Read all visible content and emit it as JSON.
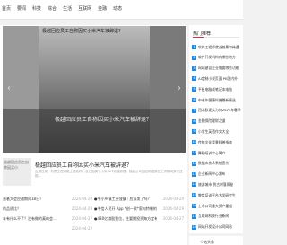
{
  "nav": [
    "首页",
    "要闻",
    "科技",
    "综合",
    "生活",
    "互联网",
    "金融",
    "动态"
  ],
  "banner": {
    "image_alt": "极越回应员工自称因买小米汽车被辞退？",
    "caption": "极越回应员工自称因买小米汽车被辞退？",
    "prev_icon": "chevron-left-icon",
    "next_icon": "chevron-right-icon"
  },
  "featured": {
    "thumb_text": "极越回应员工自称因买小",
    "title": "极越回应员工自称因买小米汽车被辞退？",
    "desc": "近期日前，有员工在网络上发帖称，自己因买了小米SU7而被辞退，随后公司回应称因其在工作期间多次违规…"
  },
  "news_left": [
    {
      "title": "营者大会应邀期间18日！",
      "date": "2024-04-29"
    },
    {
      "title": "的品质比？",
      "date": "2024-04-29"
    },
    {
      "title": "车有什么不了？没有做的真的会...",
      "date": "2024-04-27"
    },
    {
      "title": "",
      "date": "2024-04-22"
    }
  ],
  "news_right": [
    {
      "title": "●中小乡镇工业强镇｜应该发了吗？",
      "date": "2024-04-29"
    },
    {
      "title": "●中信人民开 App *创一款*家电特制的提回...",
      "date": "2024-04-29"
    },
    {
      "title": "●480亿减股到位，主要期投资每方定有哪？",
      "date": "2024-04-27"
    }
  ],
  "sidebar": {
    "title": "热门推荐",
    "items": [
      {
        "num": "1",
        "text": "软件工程师就业前景和待遇"
      },
      {
        "num": "2",
        "text": "软件开发机构有哪些地方"
      },
      {
        "num": "3",
        "text": "网站建设企业需要哪些功能"
      },
      {
        "num": "4",
        "text": "AI定制小说页面 PK国内外"
      },
      {
        "num": "5",
        "text": "平板电脑或笔记本电脑"
      },
      {
        "num": "6",
        "text": "中老年健康科普最新精选"
      },
      {
        "num": "7",
        "text": "西北欧证实为何2024年春季"
      },
      {
        "num": "8",
        "text": "金融保险理财之道"
      },
      {
        "num": "9",
        "text": "小学生英语作文大全"
      },
      {
        "num": "10",
        "text": "传统文化背景科普指南"
      },
      {
        "num": "11",
        "text": "舞蹈培训中心简介"
      },
      {
        "num": "12",
        "text": "数据库技术系统宣传"
      },
      {
        "num": "13",
        "text": "企业新闻中心发布"
      },
      {
        "num": "14",
        "text": "旅游城市 到古村落探秘"
      },
      {
        "num": "15",
        "text": "教育培训平台大学研究生"
      },
      {
        "num": "16",
        "text": "上市公司重大资产重组"
      },
      {
        "num": "17",
        "text": "互联网科技行业新闻"
      },
      {
        "num": "18",
        "text": "网站开发设计公司网站"
      }
    ]
  },
  "sidebar2": {
    "title": "个站头条"
  }
}
